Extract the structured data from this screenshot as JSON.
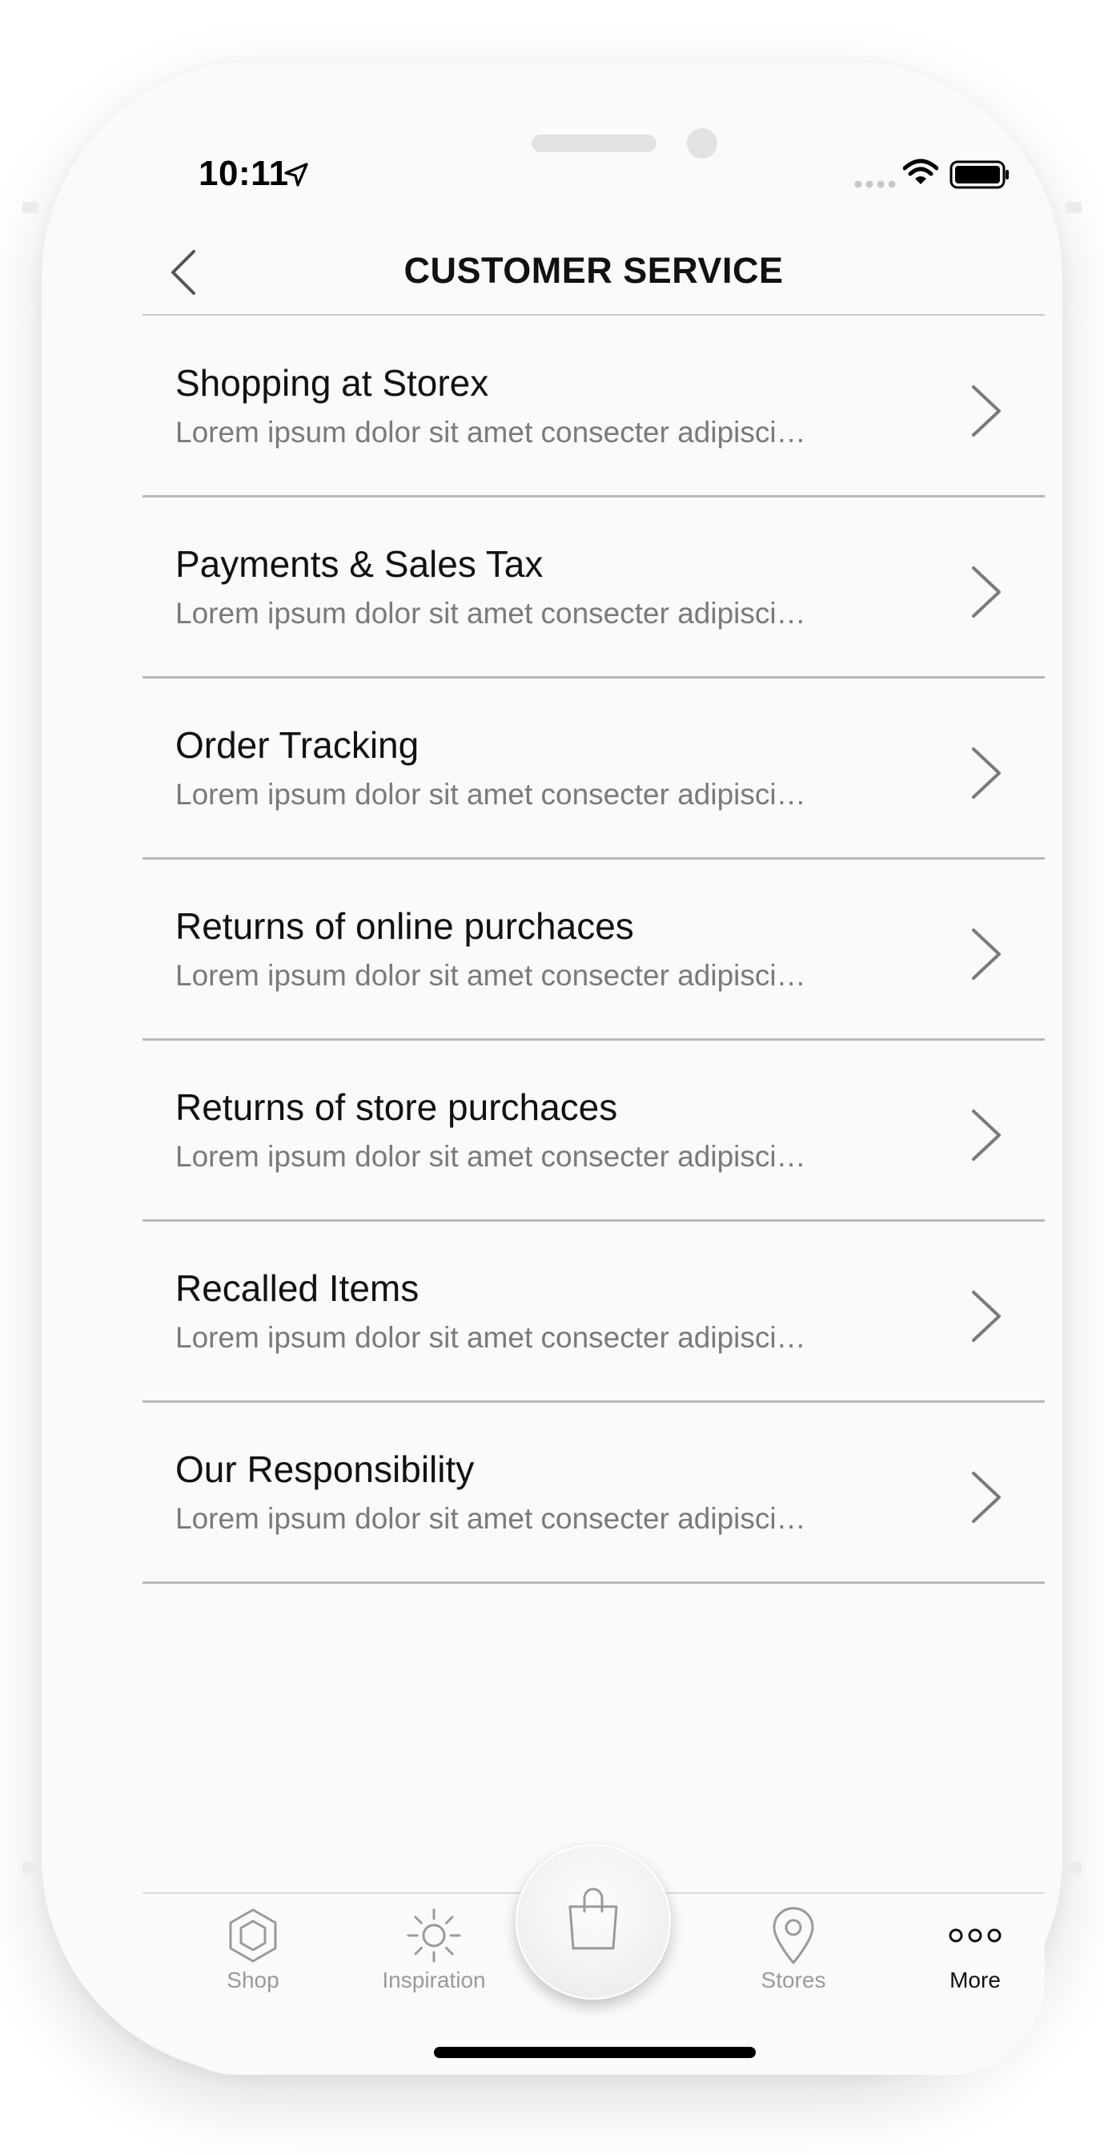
{
  "status_bar": {
    "time": "10:11"
  },
  "nav": {
    "title": "CUSTOMER SERVICE",
    "back_icon": "chevron-left-icon"
  },
  "menu": {
    "items": [
      {
        "title": "Shopping at Storex",
        "subtitle": "Lorem ipsum dolor sit amet consecter adipisci…"
      },
      {
        "title": "Payments & Sales Tax",
        "subtitle": "Lorem ipsum dolor sit amet consecter adipisci…"
      },
      {
        "title": "Order Tracking",
        "subtitle": "Lorem ipsum dolor sit amet consecter adipisci…"
      },
      {
        "title": "Returns of online purchaces",
        "subtitle": "Lorem ipsum dolor sit amet consecter adipisci…"
      },
      {
        "title": "Returns of store purchaces",
        "subtitle": "Lorem ipsum dolor sit amet consecter adipisci…"
      },
      {
        "title": "Recalled Items",
        "subtitle": "Lorem ipsum dolor sit amet consecter adipisci…"
      },
      {
        "title": "Our Responsibility",
        "subtitle": "Lorem ipsum dolor sit amet consecter adipisci…"
      }
    ]
  },
  "tabbar": {
    "tabs": [
      {
        "label": "Shop",
        "icon": "hexagon-icon",
        "active": false
      },
      {
        "label": "Inspiration",
        "icon": "sun-icon",
        "active": false
      },
      {
        "label": "Stores",
        "icon": "location-pin-icon",
        "active": false
      },
      {
        "label": "More",
        "icon": "more-dots-icon",
        "active": true
      }
    ],
    "center_button_icon": "shopping-bag-icon"
  },
  "colors": {
    "text_primary": "#111111",
    "text_secondary": "#7a7a7a",
    "divider": "#b8b8b8",
    "tab_inactive": "#9a9a9a",
    "background": "#fafafa"
  }
}
